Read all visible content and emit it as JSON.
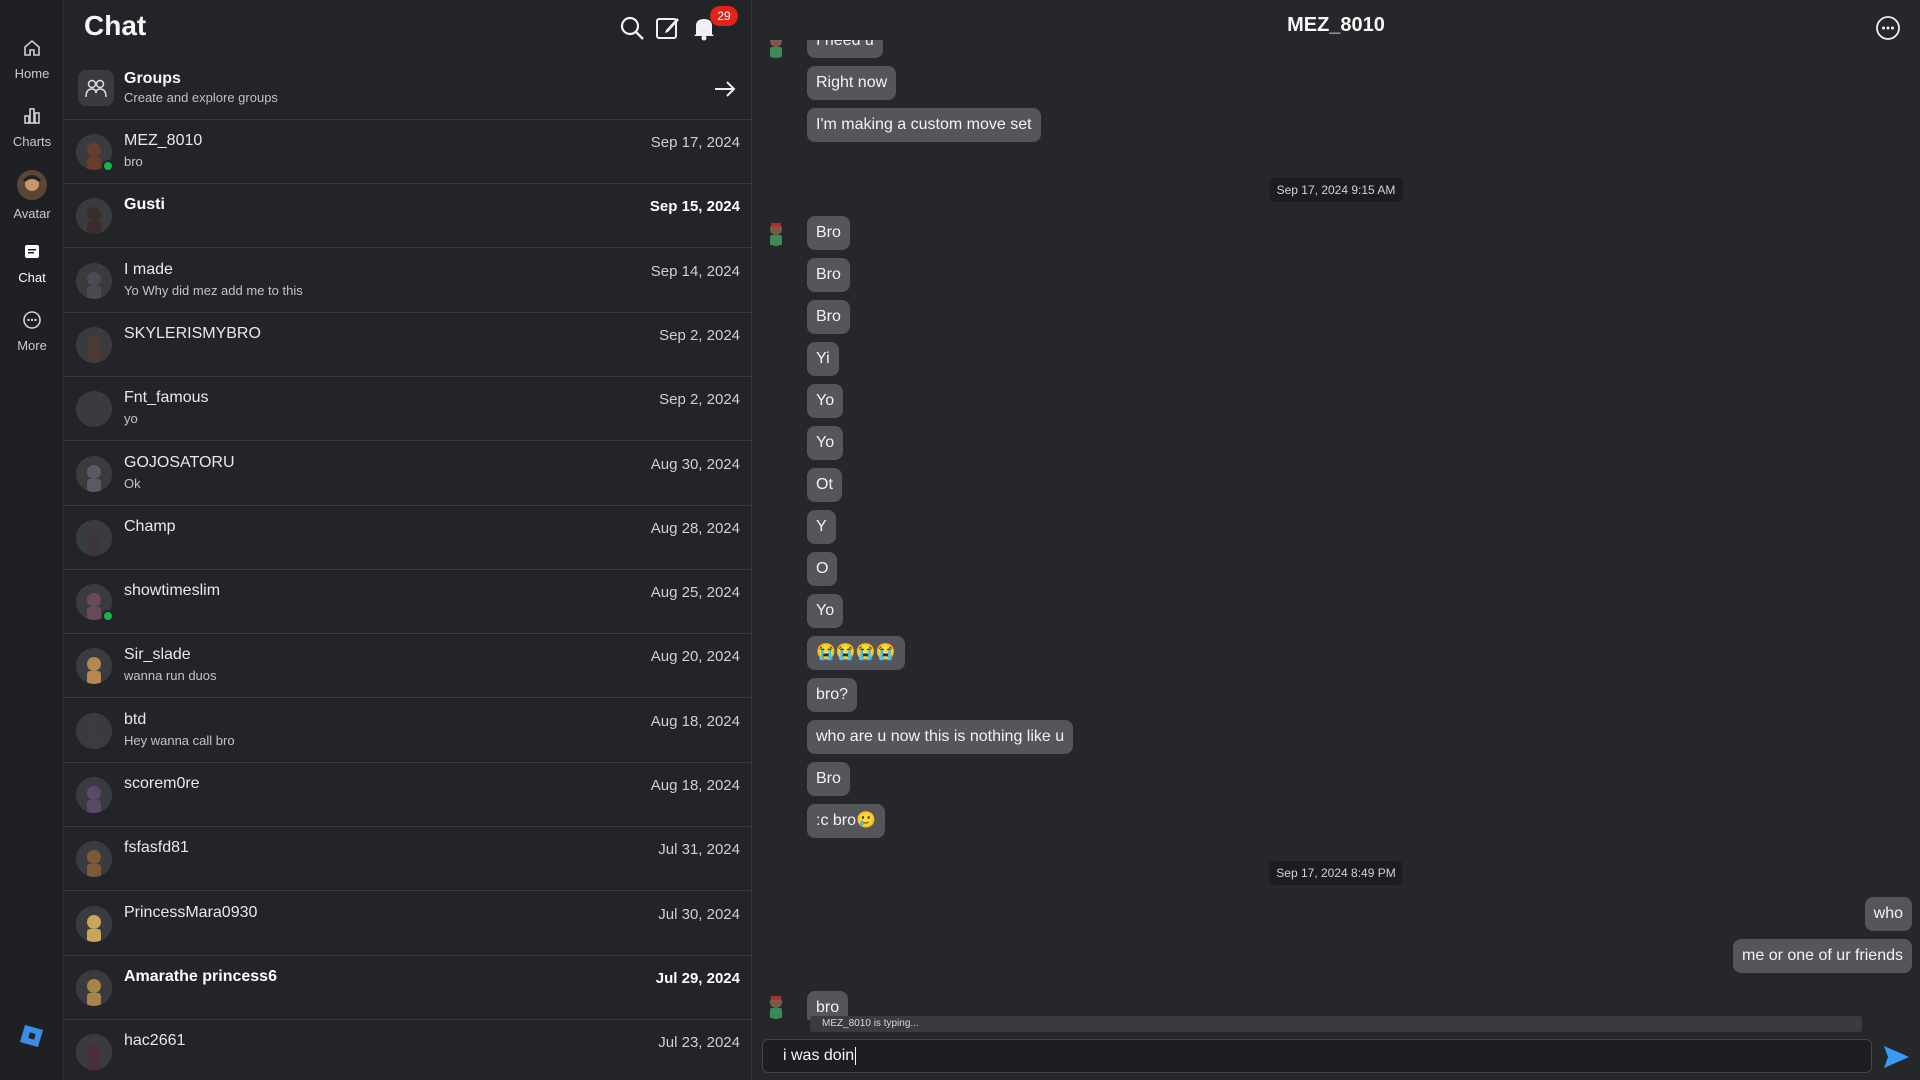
{
  "rail": {
    "items": [
      {
        "label": "Home",
        "icon": "home-icon"
      },
      {
        "label": "Charts",
        "icon": "charts-icon"
      },
      {
        "label": "Avatar",
        "icon": "avatar-icon"
      },
      {
        "label": "Chat",
        "icon": "chat-icon"
      },
      {
        "label": "More",
        "icon": "more-icon"
      }
    ],
    "logo": "roblox-logo"
  },
  "list": {
    "title": "Chat",
    "notifications_count": "29",
    "groups": {
      "title": "Groups",
      "subtitle": "Create and explore groups"
    },
    "conversations": [
      {
        "name": "MEZ_8010",
        "preview": "bro",
        "date": "Sep 17, 2024",
        "unread": false,
        "online": true
      },
      {
        "name": "Gusti",
        "preview": "",
        "date": "Sep 15, 2024",
        "unread": true,
        "online": false
      },
      {
        "name": "I made",
        "preview": "Yo Why did mez add me to this",
        "date": "Sep 14, 2024",
        "unread": false,
        "online": false
      },
      {
        "name": "SKYLERISMYBRO",
        "preview": "",
        "date": "Sep 2, 2024",
        "unread": false,
        "online": false
      },
      {
        "name": "Fnt_famous",
        "preview": "yo",
        "date": "Sep 2, 2024",
        "unread": false,
        "online": false
      },
      {
        "name": "GOJOSATORU",
        "preview": "Ok",
        "date": "Aug 30, 2024",
        "unread": false,
        "online": false
      },
      {
        "name": "Champ",
        "preview": "",
        "date": "Aug 28, 2024",
        "unread": false,
        "online": false
      },
      {
        "name": "showtimeslim",
        "preview": "",
        "date": "Aug 25, 2024",
        "unread": false,
        "online": true
      },
      {
        "name": "Sir_slade",
        "preview": "wanna run duos",
        "date": "Aug 20, 2024",
        "unread": false,
        "online": false
      },
      {
        "name": "btd",
        "preview": "Hey wanna call bro",
        "date": "Aug 18, 2024",
        "unread": false,
        "online": false
      },
      {
        "name": "scorem0re",
        "preview": "",
        "date": "Aug 18, 2024",
        "unread": false,
        "online": false
      },
      {
        "name": "fsfasfd81",
        "preview": "",
        "date": "Jul 31, 2024",
        "unread": false,
        "online": false
      },
      {
        "name": "PrincessMara0930",
        "preview": "",
        "date": "Jul 30, 2024",
        "unread": false,
        "online": false
      },
      {
        "name": "Amarathe princess6",
        "preview": "",
        "date": "Jul 29, 2024",
        "unread": true,
        "online": false
      },
      {
        "name": "hac2661",
        "preview": "",
        "date": "Jul 23, 2024",
        "unread": false,
        "online": false
      }
    ]
  },
  "conversation": {
    "title": "MEZ_8010",
    "messages_top": [
      {
        "text": "I need u",
        "dir": "in"
      },
      {
        "text": "Right now",
        "dir": "in"
      },
      {
        "text": "I'm making a custom move set",
        "dir": "in"
      }
    ],
    "timestamp_1": "Sep 17, 2024 9:15 AM",
    "messages_mid": [
      {
        "text": "Bro"
      },
      {
        "text": "Bro"
      },
      {
        "text": "Bro"
      },
      {
        "text": "Yi"
      },
      {
        "text": "Yo"
      },
      {
        "text": "Yo"
      },
      {
        "text": "Ot"
      },
      {
        "text": "Y"
      },
      {
        "text": "O"
      },
      {
        "text": "Yo"
      },
      {
        "text": "😭😭😭😭"
      },
      {
        "text": "bro?"
      },
      {
        "text": "who are u now this is nothing like u"
      },
      {
        "text": "Bro"
      },
      {
        "text": ":c bro🥲"
      }
    ],
    "timestamp_2": "Sep 17, 2024 8:49 PM",
    "messages_out": [
      {
        "text": "who"
      },
      {
        "text": "me or one of ur friends"
      }
    ],
    "last_in": "bro",
    "typing": "MEZ_8010 is typing...",
    "input_value": "i was doin"
  }
}
